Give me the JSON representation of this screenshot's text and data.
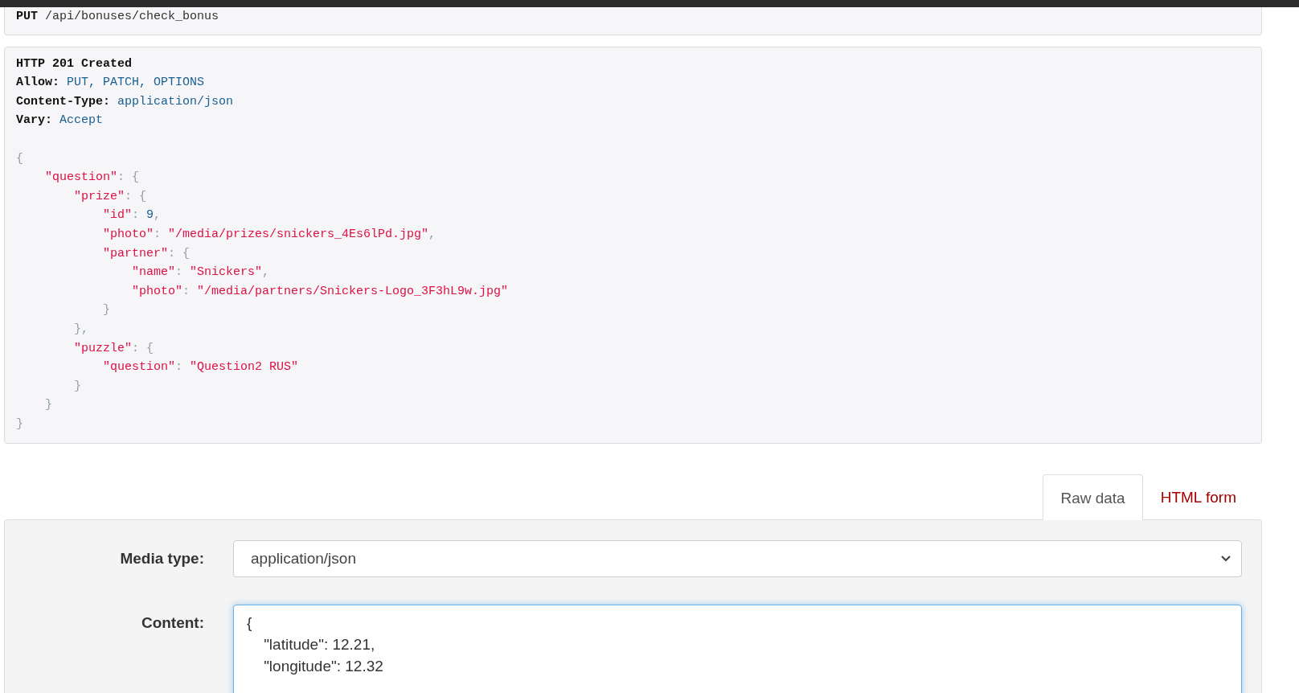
{
  "request": {
    "method": "PUT",
    "path": "/api/bonuses/check_bonus"
  },
  "response": {
    "status": "HTTP 201 Created",
    "headers": [
      {
        "name": "Allow:",
        "value": "PUT, PATCH, OPTIONS"
      },
      {
        "name": "Content-Type:",
        "value": "application/json"
      },
      {
        "name": "Vary:",
        "value": "Accept"
      }
    ],
    "body": [
      [
        {
          "kind": "punct",
          "text": "{"
        }
      ],
      [
        {
          "kind": "string",
          "text": "    \"question\""
        },
        {
          "kind": "punct",
          "text": ": {"
        }
      ],
      [
        {
          "kind": "string",
          "text": "        \"prize\""
        },
        {
          "kind": "punct",
          "text": ": {"
        }
      ],
      [
        {
          "kind": "string",
          "text": "            \"id\""
        },
        {
          "kind": "punct",
          "text": ": "
        },
        {
          "kind": "number",
          "text": "9"
        },
        {
          "kind": "punct",
          "text": ","
        }
      ],
      [
        {
          "kind": "string",
          "text": "            \"photo\""
        },
        {
          "kind": "punct",
          "text": ": "
        },
        {
          "kind": "string",
          "text": "\"/media/prizes/snickers_4Es6lPd.jpg\""
        },
        {
          "kind": "punct",
          "text": ","
        }
      ],
      [
        {
          "kind": "string",
          "text": "            \"partner\""
        },
        {
          "kind": "punct",
          "text": ": {"
        }
      ],
      [
        {
          "kind": "string",
          "text": "                \"name\""
        },
        {
          "kind": "punct",
          "text": ": "
        },
        {
          "kind": "string",
          "text": "\"Snickers\""
        },
        {
          "kind": "punct",
          "text": ","
        }
      ],
      [
        {
          "kind": "string",
          "text": "                \"photo\""
        },
        {
          "kind": "punct",
          "text": ": "
        },
        {
          "kind": "string",
          "text": "\"/media/partners/Snickers-Logo_3F3hL9w.jpg\""
        }
      ],
      [
        {
          "kind": "punct",
          "text": "            }"
        }
      ],
      [
        {
          "kind": "punct",
          "text": "        },"
        }
      ],
      [
        {
          "kind": "string",
          "text": "        \"puzzle\""
        },
        {
          "kind": "punct",
          "text": ": {"
        }
      ],
      [
        {
          "kind": "string",
          "text": "            \"question\""
        },
        {
          "kind": "punct",
          "text": ": "
        },
        {
          "kind": "string",
          "text": "\"Question2 RUS\""
        }
      ],
      [
        {
          "kind": "punct",
          "text": "        }"
        }
      ],
      [
        {
          "kind": "punct",
          "text": "    }"
        }
      ],
      [
        {
          "kind": "punct",
          "text": "}"
        }
      ]
    ]
  },
  "tabs": [
    {
      "label": "Raw data",
      "selected": true
    },
    {
      "label": "HTML form",
      "selected": false
    }
  ],
  "form": {
    "media_type_label": "Media type:",
    "media_type": "application/json",
    "content_label": "Content:",
    "content": "{\n    \"latitude\": 12.21,\n    \"longitude\": 12.32"
  }
}
